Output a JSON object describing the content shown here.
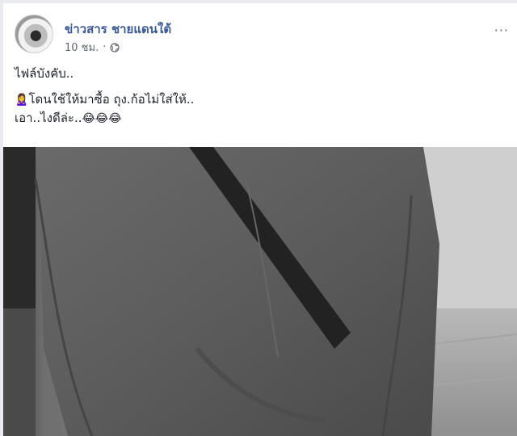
{
  "post": {
    "author": "ข่าวสาร ชายแดนใต้",
    "time": "10 ชม.",
    "separator": "·",
    "privacy_icon": "globe-icon",
    "more_label": "···",
    "text_line1": "ไฟล์บังคับ..",
    "text_line2_emoji": "🙎‍♀️",
    "text_line2": "โดนใช้ให้มาซื้อ ถุง.ก้อไม่ใส่ให้..",
    "text_line3": "เอา..ไงดีล่ะ..",
    "text_line3_emojis": "😂😂😂",
    "photo_icon": "photo-icon"
  },
  "colors": {
    "author": "#385898",
    "meta": "#616770",
    "text": "#1d2129",
    "background": "#e9ebee"
  }
}
